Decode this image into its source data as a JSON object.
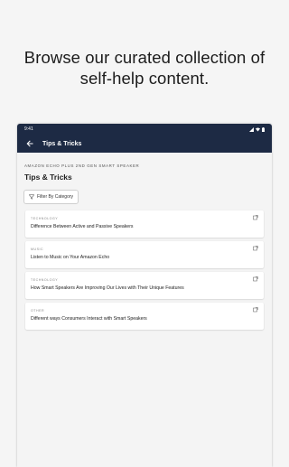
{
  "promo": {
    "line1": "Browse our curated collection of",
    "line2": "self-help content."
  },
  "statusbar": {
    "time": "9:41"
  },
  "appbar": {
    "title": "Tips & Tricks"
  },
  "page": {
    "subheading": "AMAZON ECHO PLUS 2ND GEN SMART SPEAKER",
    "title": "Tips & Tricks",
    "filter_label": "Filter By Category"
  },
  "cards": [
    {
      "category": "TECHNOLOGY",
      "title": "Difference Between Active and Passive Speakers"
    },
    {
      "category": "MUSIC",
      "title": "Listen to Music on Your Amazon Echo"
    },
    {
      "category": "TECHNOLOGY",
      "title": "How Smart Speakers Are Improving Our Lives with Their Unique Features"
    },
    {
      "category": "OTHER",
      "title": "Different ways Consumers Interact with Smart Speakers"
    }
  ],
  "colors": {
    "appbar": "#1d2a44",
    "background": "#f5f5f5"
  },
  "icons": {
    "back": "arrow-left-icon",
    "filter": "funnel-icon",
    "card": "open-external-icon"
  }
}
